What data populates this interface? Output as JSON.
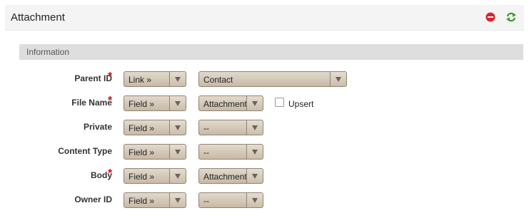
{
  "header": {
    "title": "Attachment",
    "remove_icon": "remove-circle-icon",
    "refresh_icon": "refresh-icon",
    "remove_color": "#d9232e",
    "refresh_color": "#3c9a2f"
  },
  "section": {
    "title": "Information"
  },
  "required_marker": "*",
  "rows": [
    {
      "label": "Parent ID",
      "required": true,
      "type_value": "Link »",
      "field_value": "Contact"
    },
    {
      "label": "File Name",
      "required": true,
      "type_value": "Field »",
      "field_value": "Attachment",
      "upsert_label": "Upsert"
    },
    {
      "label": "Private",
      "required": false,
      "type_value": "Field »",
      "field_value": "--"
    },
    {
      "label": "Content Type",
      "required": false,
      "type_value": "Field »",
      "field_value": "--"
    },
    {
      "label": "Body",
      "required": true,
      "type_value": "Field »",
      "field_value": "Attachment"
    },
    {
      "label": "Owner ID",
      "required": false,
      "type_value": "Field »",
      "field_value": "--"
    }
  ]
}
